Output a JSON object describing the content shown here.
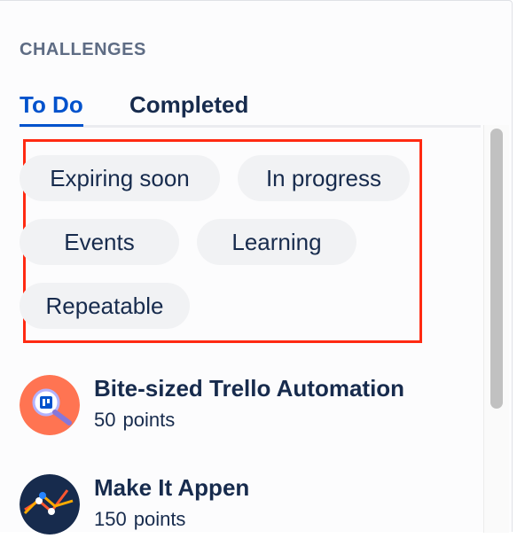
{
  "panel": {
    "heading": "CHALLENGES",
    "tabs": [
      {
        "label": "To Do",
        "active": true
      },
      {
        "label": "Completed",
        "active": false
      }
    ]
  },
  "filters": [
    {
      "label": "Expiring soon"
    },
    {
      "label": "In progress"
    },
    {
      "label": "Events"
    },
    {
      "label": "Learning"
    },
    {
      "label": "Repeatable"
    }
  ],
  "challenges": [
    {
      "title": "Bite-sized Trello Automation",
      "points": "50",
      "points_label": "points",
      "icon": "trello-automation-icon",
      "color": "#ff7452"
    },
    {
      "title": "Make It Appen",
      "points": "150",
      "points_label": "points",
      "icon": "line-graph-icon",
      "color": "#172b4d"
    }
  ],
  "colors": {
    "accent": "#0052cc",
    "highlight": "#ff2a12",
    "chip_bg": "#f1f2f4",
    "heading": "#5e6c84"
  }
}
